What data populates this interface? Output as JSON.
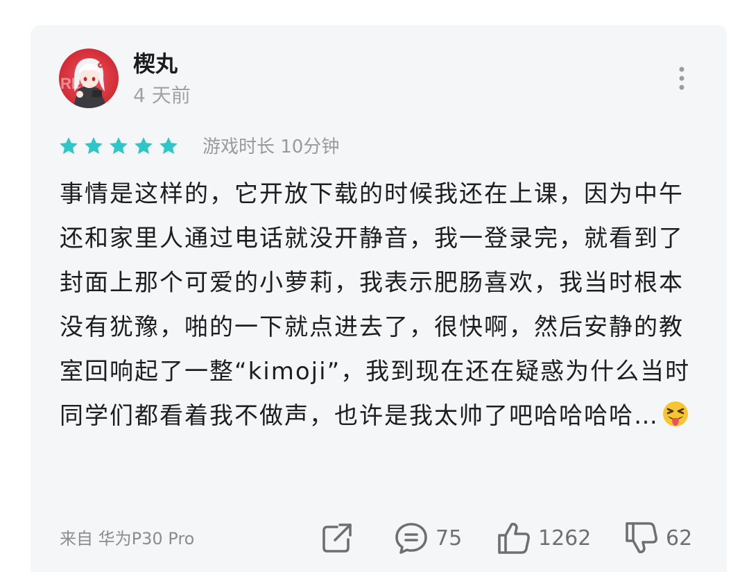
{
  "review": {
    "username": "楔丸",
    "time": "4 天前",
    "rating": 5,
    "playtime": "游戏时长 10分钟",
    "text": "事情是这样的，它开放下载的时候我还在上课，因为中午还和家里人通过电话就没开静音，我一登录完，就看到了封面上那个可爱的小萝莉，我表示肥肠喜欢，我当时根本没有犹豫，啪的一下就点进去了，很快啊，然后安静的教室回响起了一整“kimoji”，我到现在还在疑惑为什么当时同学们都看着我不做声，也许是我太帅了吧哈哈哈哈…",
    "device": "来自 华为P30 Pro"
  },
  "actions": {
    "comments": "75",
    "likes": "1262",
    "dislikes": "62"
  },
  "icons": {
    "star_color": "#2ec6c8",
    "more": "more-vertical-icon",
    "share": "share-icon",
    "comment": "comment-icon",
    "like": "thumbs-up-icon",
    "dislike": "thumbs-down-icon",
    "emoji": "squinting-tongue-emoji"
  }
}
